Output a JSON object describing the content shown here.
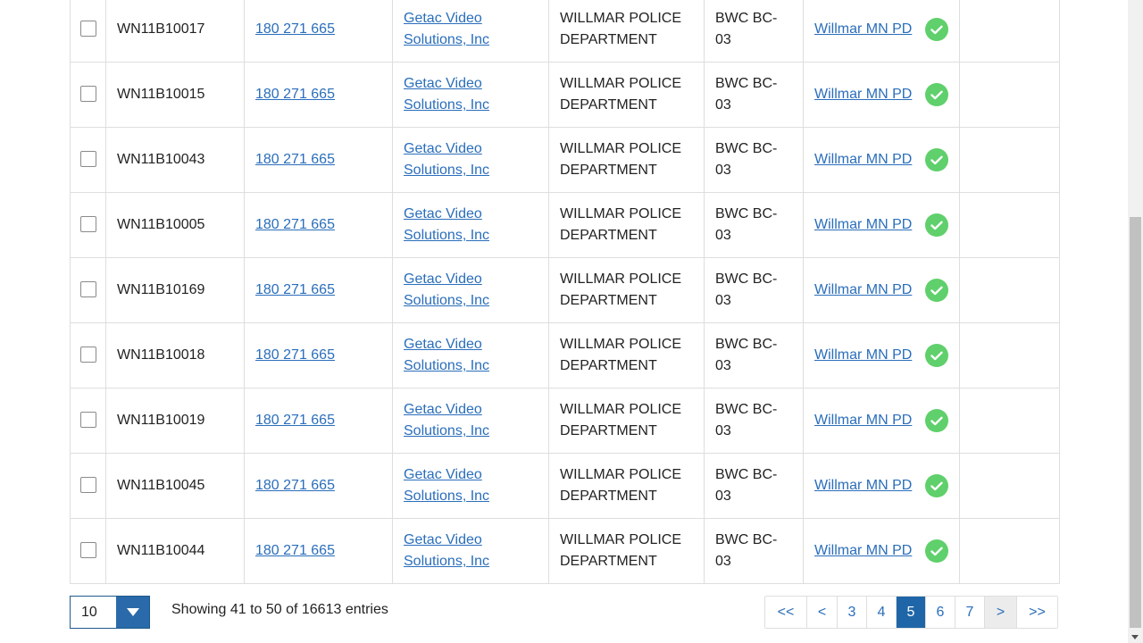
{
  "rows": [
    {
      "serial": "WN11B10017",
      "order": "180 271 665",
      "vendor": "Getac Video Solutions, Inc",
      "agency": "WILLMAR POLICE DEPARTMENT",
      "model": "BWC BC-03",
      "owner": "Willmar MN PD"
    },
    {
      "serial": "WN11B10015",
      "order": "180 271 665",
      "vendor": "Getac Video Solutions, Inc",
      "agency": "WILLMAR POLICE DEPARTMENT",
      "model": "BWC BC-03",
      "owner": "Willmar MN PD"
    },
    {
      "serial": "WN11B10043",
      "order": "180 271 665",
      "vendor": "Getac Video Solutions, Inc",
      "agency": "WILLMAR POLICE DEPARTMENT",
      "model": "BWC BC-03",
      "owner": "Willmar MN PD"
    },
    {
      "serial": "WN11B10005",
      "order": "180 271 665",
      "vendor": "Getac Video Solutions, Inc",
      "agency": "WILLMAR POLICE DEPARTMENT",
      "model": "BWC BC-03",
      "owner": "Willmar MN PD"
    },
    {
      "serial": "WN11B10169",
      "order": "180 271 665",
      "vendor": "Getac Video Solutions, Inc",
      "agency": "WILLMAR POLICE DEPARTMENT",
      "model": "BWC BC-03",
      "owner": "Willmar MN PD"
    },
    {
      "serial": "WN11B10018",
      "order": "180 271 665",
      "vendor": "Getac Video Solutions, Inc",
      "agency": "WILLMAR POLICE DEPARTMENT",
      "model": "BWC BC-03",
      "owner": "Willmar MN PD"
    },
    {
      "serial": "WN11B10019",
      "order": "180 271 665",
      "vendor": "Getac Video Solutions, Inc",
      "agency": "WILLMAR POLICE DEPARTMENT",
      "model": "BWC BC-03",
      "owner": "Willmar MN PD"
    },
    {
      "serial": "WN11B10045",
      "order": "180 271 665",
      "vendor": "Getac Video Solutions, Inc",
      "agency": "WILLMAR POLICE DEPARTMENT",
      "model": "BWC BC-03",
      "owner": "Willmar MN PD"
    },
    {
      "serial": "WN11B10044",
      "order": "180 271 665",
      "vendor": "Getac Video Solutions, Inc",
      "agency": "WILLMAR POLICE DEPARTMENT",
      "model": "BWC BC-03",
      "owner": "Willmar MN PD"
    }
  ],
  "status_icon": "check-circle-icon",
  "colors": {
    "accent": "#1f66a8",
    "link": "#2a6ebb",
    "success": "#5fd06b"
  },
  "pagination": {
    "page_size": "10",
    "info": "Showing 41 to 50 of 16613 entries",
    "first_label": "<<",
    "prev_label": "<",
    "pages": [
      "3",
      "4",
      "5",
      "6",
      "7"
    ],
    "current_page": "5",
    "next_label": ">",
    "last_label": ">>"
  }
}
